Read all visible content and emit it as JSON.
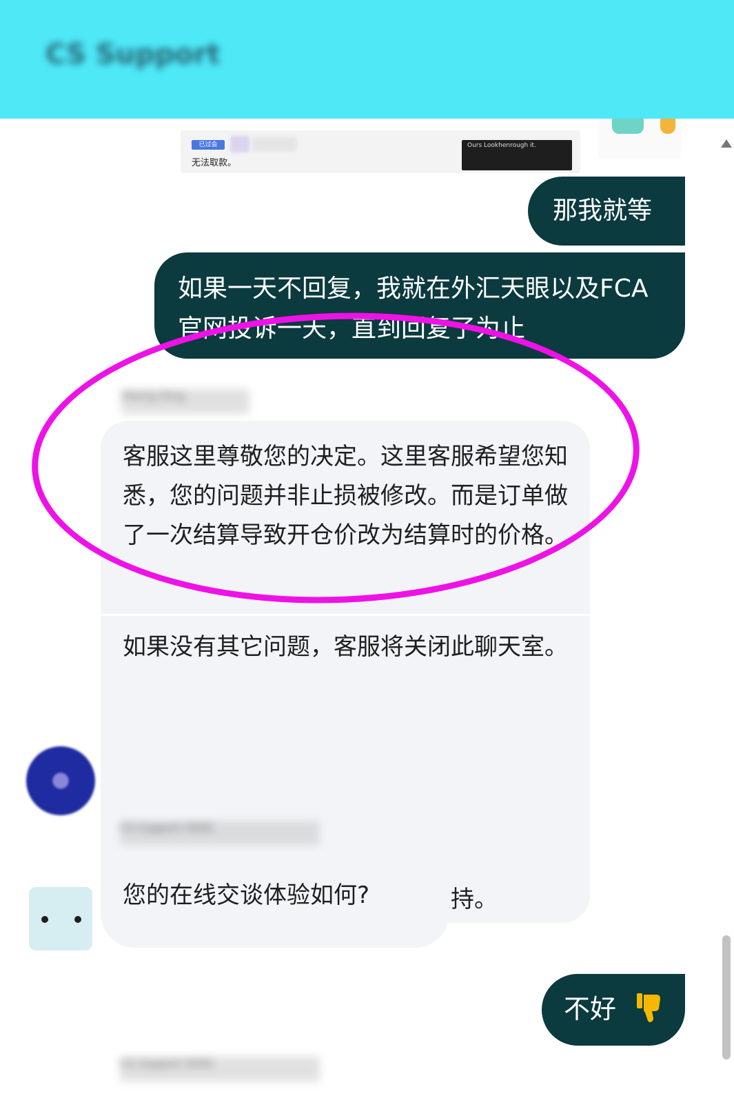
{
  "header": {
    "title": "CS Support"
  },
  "preview": {
    "tag_label": "已过会",
    "text": "无法取款。",
    "dark_panel_text": "Ours Lookhenrough it."
  },
  "messages": {
    "user_1": "那我就等",
    "user_2": "如果一天不回复，我就在外汇天眼以及FCA官网投诉一天，直到回复了为止",
    "agent_name": "Sheng Ding",
    "agent_p1": "客服这里尊敬您的决定。这里客服希望您知悉，您的问题并非止损被修改。而是订单做了一次结算导致开仓价改为结算时的价格。",
    "agent_p2": "如果没有其它问题，客服将关闭此聊天室。",
    "agent_p3": "客服再次感谢您的耐心等待和支持。",
    "bot_name": "CS Support 0000",
    "bot_question": "您的在线交谈体验如何?",
    "user_rating": "不好",
    "footer_sender": "CS Support 0000"
  },
  "colors": {
    "header_bg": "#4ee8f7",
    "outgoing_bubble": "#0b3a3f",
    "incoming_bubble": "#f2f4f7",
    "highlight_ring": "#ee12e6",
    "thumbs_down": "#f5b800"
  },
  "icons": {
    "rating": "thumbs-down-icon",
    "bot": "bot-face-icon"
  }
}
